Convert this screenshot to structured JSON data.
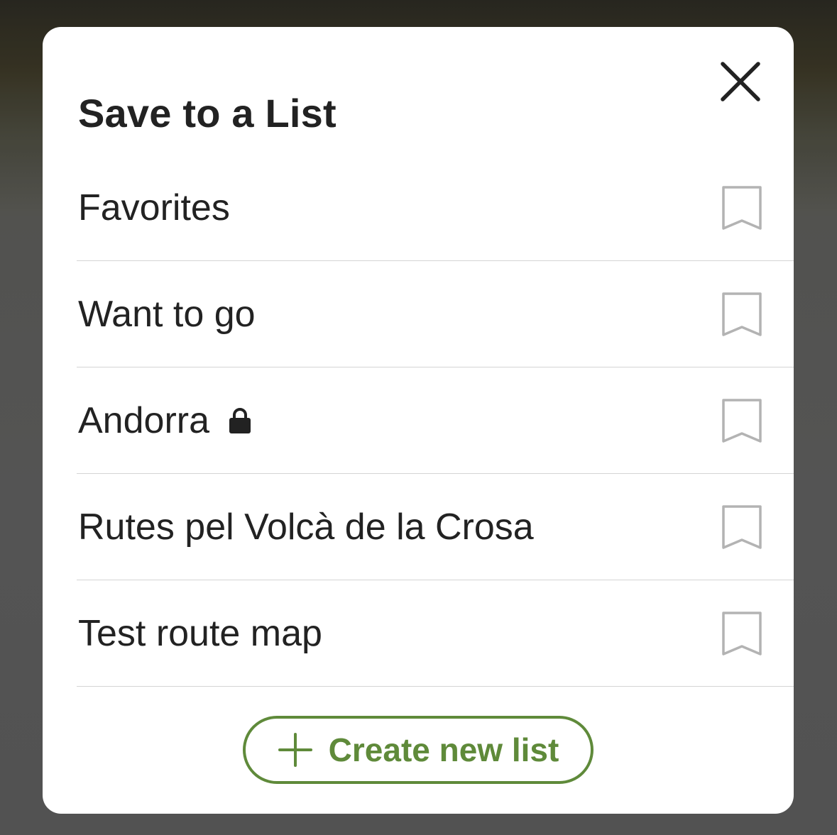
{
  "modal": {
    "title": "Save to a List",
    "close_icon": "close-icon"
  },
  "lists": [
    {
      "label": "Favorites",
      "private": false,
      "icon": "bookmark-icon"
    },
    {
      "label": "Want to go",
      "private": false,
      "icon": "bookmark-icon"
    },
    {
      "label": "Andorra",
      "private": true,
      "icon": "bookmark-icon",
      "private_icon": "lock-icon"
    },
    {
      "label": "Rutes pel Volcà de la Crosa",
      "private": false,
      "icon": "bookmark-icon"
    },
    {
      "label": "Test route map",
      "private": false,
      "icon": "bookmark-icon"
    }
  ],
  "create_button": {
    "label": "Create new list",
    "icon": "plus-icon"
  },
  "colors": {
    "accent": "#5f8a3a",
    "text": "#222222",
    "bookmark_outline": "#b3b3b3",
    "divider": "#d4d4d4"
  }
}
